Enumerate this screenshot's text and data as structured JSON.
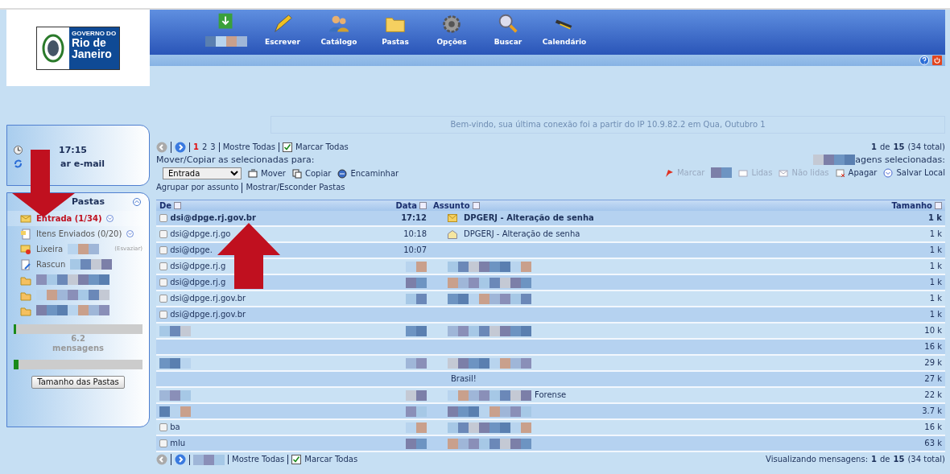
{
  "logo": [
    "GOVERNO DO",
    "Rio de",
    "Janeiro"
  ],
  "nav": {
    "items": [
      {
        "kind": "inbox"
      },
      {
        "kind": "compose",
        "label": "Escrever"
      },
      {
        "kind": "contacts",
        "label": "Catálogo"
      },
      {
        "kind": "folders",
        "label": "Pastas"
      },
      {
        "kind": "options",
        "label": "Opções"
      },
      {
        "kind": "search",
        "label": "Buscar"
      },
      {
        "kind": "calendar",
        "label": "Calendário"
      }
    ]
  },
  "welcome": "Bem-vindo, sua última conexão foi a partir do IP 10.9.82.2 em Qua, Outubro 1",
  "clock": {
    "time": "17:15",
    "refresh": "ar e-mail"
  },
  "folders_panel": {
    "title": "Pastas",
    "folders": [
      {
        "kind": "inbox",
        "label": "Entrada",
        "count": "(1/34)",
        "selected": true
      },
      {
        "kind": "sent",
        "label": "Itens Enviados",
        "count": "(0/20)",
        "selected": false
      },
      {
        "kind": "trash",
        "label": "Lixeira",
        "action": "(Esvaziar)",
        "selected": false
      },
      {
        "kind": "drafts",
        "label": "Rascun",
        "selected": false
      },
      {
        "kind": "obscured",
        "selected": false
      },
      {
        "kind": "obscured",
        "selected": false
      },
      {
        "kind": "obscured",
        "selected": false
      }
    ],
    "quota": [
      {
        "level": 0.02
      },
      {
        "text": "6.2"
      },
      {
        "text": "mensagens"
      },
      {
        "level": 0.04
      }
    ],
    "button": "Tamanho das Pastas"
  },
  "pager_top": {
    "pages": [
      {
        "label": "1",
        "selected": true
      },
      {
        "label": "2",
        "selected": false
      },
      {
        "label": "3",
        "selected": false
      }
    ],
    "show_all": "Mostre Todas",
    "mark_all": "Marcar Todas",
    "summary": "**1** de **15** (34 total)"
  },
  "move": {
    "label": "Mover/Copiar as selecionadas para:",
    "folder": "Entrada",
    "actions": [
      "Mover",
      "Copiar",
      "Encaminhar"
    ],
    "group": "Agrupar por assunto",
    "toggle": "Mostrar/Esconder Pastas"
  },
  "selected_actions": {
    "label": "agens selecionadas:",
    "actions": [
      {
        "kind": "flag",
        "label": "Marcar",
        "disabled": true
      },
      {
        "kind": "read",
        "label": "Lidas",
        "disabled": true
      },
      {
        "kind": "unread",
        "label": "Não lidas",
        "disabled": true
      },
      {
        "kind": "delete",
        "label": "Apagar",
        "disabled": false
      },
      {
        "kind": "save",
        "label": "Salvar Local",
        "disabled": false
      }
    ]
  },
  "table": {
    "columns": [
      "De",
      "Data",
      "Assunto",
      "Tamanho"
    ],
    "rows": [
      {
        "from": "dsi@dpge.rj.gov.br",
        "date": "17:12",
        "subject": "DPGERJ - Alteração de senha",
        "size": "1 k",
        "unread": true,
        "checked": false,
        "obscured": false
      },
      {
        "from": "dsi@dpge.rj.go",
        "date": "10:18",
        "subject": "DPGERJ - Alteração de senha",
        "size": "1 k",
        "unread": false,
        "checked": false,
        "obscured": false
      },
      {
        "from": "dsi@dpge.",
        "date": "10:07",
        "size": "1 k",
        "unread": false,
        "checked": false,
        "obscured": false
      },
      {
        "from": "dsi@dpge.rj.g",
        "size": "1 k",
        "checked": false,
        "obscured": true
      },
      {
        "from": "dsi@dpge.rj.g",
        "size": "1 k",
        "checked": false,
        "obscured": true
      },
      {
        "from": "dsi@dpge.rj.gov.br",
        "size": "1 k",
        "checked": false,
        "obscured": true
      },
      {
        "from": "dsi@dpge.rj.gov.br",
        "size": "1 k",
        "checked": false,
        "obscured": false
      },
      {
        "size": "10 k",
        "obscured": true
      },
      {
        "size": "16 k",
        "obscured": false
      },
      {
        "size": "29 k",
        "obscured": true
      },
      {
        "subject": "Brasil!",
        "size": "27 k",
        "obscured": false
      },
      {
        "subject": "Forense",
        "size": "22 k",
        "obscured": true
      },
      {
        "size": "3.7 k",
        "obscured": true
      },
      {
        "from": "ba",
        "size": "16 k",
        "checked": false,
        "obscured": true
      },
      {
        "from": "mlu",
        "size": "63 k",
        "checked": false,
        "obscured": true
      }
    ]
  },
  "pager_bottom": {
    "show_all": "Mostre Todas",
    "mark_all": "Marcar Todas",
    "summary": "Visualizando mensagens: **1** de **15** (34 total)"
  }
}
